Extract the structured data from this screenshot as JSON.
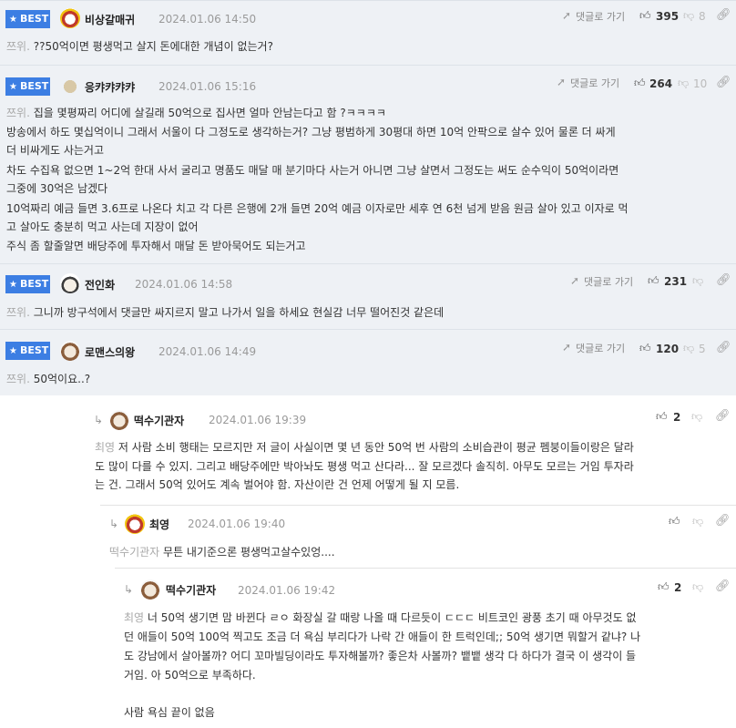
{
  "best_label": "BEST",
  "reply_label": "댓글로 가기",
  "comments": [
    {
      "nick": "비상갈매귀",
      "date": "2024.01.06 14:50",
      "up": "395",
      "down": "8",
      "prefix": "쯔위.",
      "lines": [
        "??50억이면 평생먹고 살지 돈에대한 개념이 없는거?"
      ]
    },
    {
      "nick": "응캬캬캬캬",
      "date": "2024.01.06 15:16",
      "up": "264",
      "down": "10",
      "prefix": "쯔위.",
      "lines": [
        "집을 몇평짜리 어디에 살길래 50억으로 집사면 얼마 안남는다고 함 ?ㅋㅋㅋㅋ",
        "방송에서 하도 몇십억이니 그래서 서울이 다 그정도로 생각하는거? 그냥 평범하게 30평대 하면 10억 안팍으로 살수 있어 물론 더 싸게",
        "더 비싸게도 사는거고",
        "차도 수집욕 없으면 1~2억 한대 사서 굴리고 명품도 매달 매 분기마다 사는거 아니면 그냥 살면서 그정도는 써도 순수익이 50억이라면",
        "그중에 30억은 남겠다",
        "10억짜리 예금 들면 3.6프로 나온다 치고 각 다른 은행에 2개 들면 20억 예금 이자로만 세후 연 6천 넘게 받음 원금 살아 있고 이자로 먹",
        "고 살아도 충분히 먹고 사는데 지장이 없어",
        "주식 좀 할줄알면 배당주에 투자해서 매달 돈 받아묵어도 되는거고"
      ]
    },
    {
      "nick": "전인화",
      "date": "2024.01.06 14:58",
      "up": "231",
      "prefix": "쯔위.",
      "lines": [
        "그니까 방구석에서 댓글만 싸지르지 말고 나가서 일을 하세요 현실감 너무 떨어진것 같은데"
      ]
    },
    {
      "nick": "로맨스의왕",
      "date": "2024.01.06 14:49",
      "up": "120",
      "down": "5",
      "prefix": "쯔위.",
      "lines": [
        "50억이요..?"
      ]
    }
  ],
  "replies": [
    {
      "nick": "떡수기관자",
      "date": "2024.01.06 19:39",
      "up": "2",
      "prefix": "최영",
      "lines": [
        "저 사람 소비 행태는 모르지만 저 글이 사실이면 몇 년 동안 50억 번 사람의 소비습관이 평균 펨붕이들이랑은 달라",
        "도 많이 다를 수 있지. 그리고 배당주에만 박아놔도 평생 먹고 산다라... 잘 모르겠다 솔직히. 아무도 모르는 거임 투자라",
        "는 건. 그래서 50억 있어도 계속 벌어야 함. 자산이란 건 언제 어떻게 될 지 모름."
      ]
    },
    {
      "nick": "최영",
      "date": "2024.01.06 19:40",
      "prefix": "떡수기관자",
      "lines": [
        "무튼 내기준으론 평생먹고살수있엉...."
      ]
    },
    {
      "nick": "떡수기관자",
      "date": "2024.01.06 19:42",
      "up": "2",
      "prefix": "최영",
      "lines": [
        "너 50억 생기면 맘 바뀐다 ㄹㅇ 화장실 갈 때랑 나올 때 다르듯이 ㄷㄷㄷ 비트코인 광풍 초기 때 아무것도 없",
        "던 애들이 50억 100억 찍고도 조금 더 욕심 부리다가 나락 간 애들이 한 트럭인데;; 50억 생기면 뭐할거 같냐? 나",
        "도 강남에서 살아볼까? 어디 꼬마빌딩이라도 투자해볼까? 좋은차 사볼까? 뱉뱉 생각 다 하다가 결국 이 생각이 들",
        "거임. 아 50억으로 부족하다.",
        "",
        "사람 욕심 끝이 없음"
      ]
    }
  ]
}
